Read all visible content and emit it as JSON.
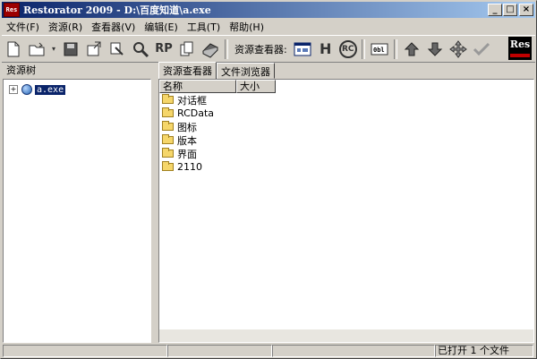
{
  "window": {
    "title": "Restorator 2009 - D:\\百度知道\\a.exe",
    "icon_text": "Res",
    "minimize": "_",
    "maximize": "□",
    "close": "×"
  },
  "menu": [
    {
      "label": "文件(F)"
    },
    {
      "label": "资源(R)"
    },
    {
      "label": "查看器(V)"
    },
    {
      "label": "编辑(E)"
    },
    {
      "label": "工具(T)"
    },
    {
      "label": "帮助(H)"
    }
  ],
  "toolbar": {
    "viewer_label": "资源查看器:",
    "rp_text": "RP",
    "h_text": "H",
    "rc_text": "RC",
    "logo_text": "Res",
    "icons": [
      "new-file-icon",
      "open-folder-icon",
      "save-icon",
      "export-icon",
      "find-replace-icon",
      "search-icon",
      "rp-icon",
      "copy-icon",
      "book-icon",
      "viewer-window-icon",
      "h-icon",
      "rc-icon",
      "hex-icon",
      "arrow-up-icon",
      "arrow-down-icon",
      "move-icon",
      "checkmark-icon",
      "res-logo-icon"
    ]
  },
  "left_panel": {
    "header": "资源树",
    "tree": [
      {
        "label": "a.exe",
        "expander": "+"
      }
    ]
  },
  "tabs": [
    {
      "label": "资源查看器",
      "active": true
    },
    {
      "label": "文件浏览器",
      "active": false
    }
  ],
  "list": {
    "columns": [
      "名称",
      "大小"
    ],
    "rows": [
      {
        "name": "对话框",
        "size": ""
      },
      {
        "name": "RCData",
        "size": ""
      },
      {
        "name": "图标",
        "size": ""
      },
      {
        "name": "版本",
        "size": ""
      },
      {
        "name": "界面",
        "size": ""
      },
      {
        "name": "2110",
        "size": ""
      }
    ]
  },
  "status": {
    "panel1": "",
    "panel2": "",
    "panel3": "",
    "panel4": "已打开 1 个文件"
  }
}
